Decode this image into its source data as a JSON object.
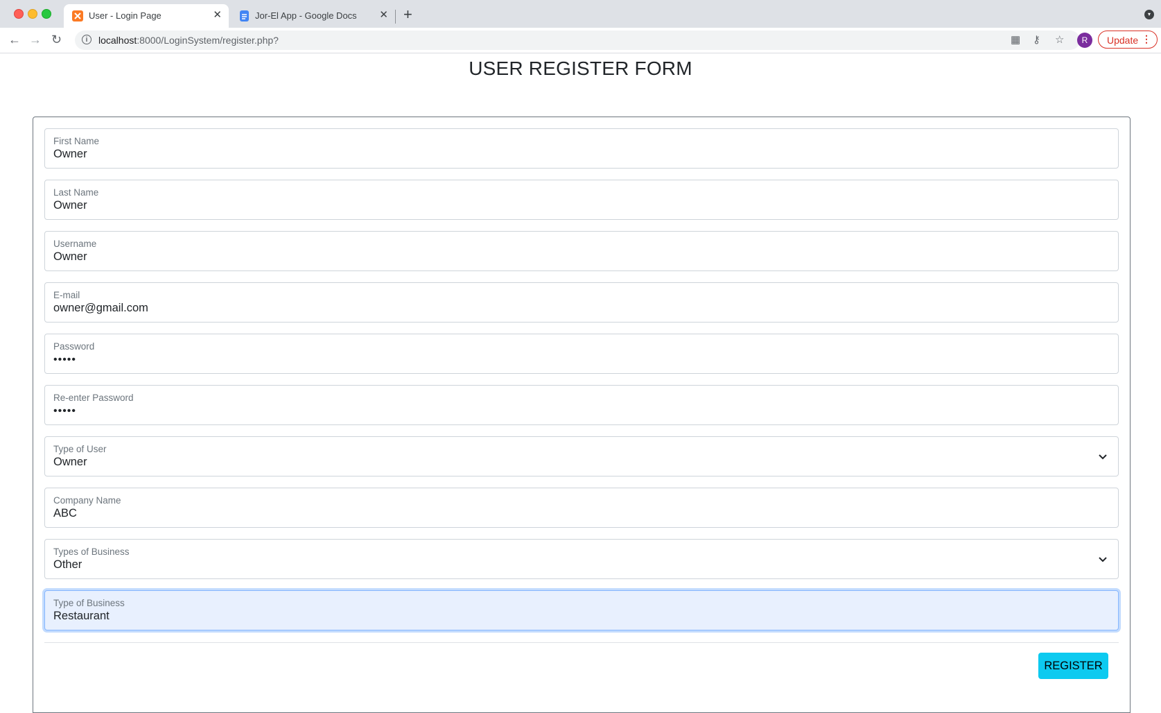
{
  "browser": {
    "tabs": [
      {
        "title": "User - Login Page",
        "active": true,
        "favicon": "xampp-icon"
      },
      {
        "title": "Jor-El App - Google Docs",
        "active": false,
        "favicon": "google-docs-icon"
      }
    ],
    "url_host": "localhost",
    "url_path": ":8000/LoginSystem/register.php?",
    "avatar_letter": "R",
    "update_label": "Update"
  },
  "page": {
    "heading": "USER REGISTER FORM",
    "fields": {
      "first_name": {
        "label": "First Name",
        "value": "Owner"
      },
      "last_name": {
        "label": "Last Name",
        "value": "Owner"
      },
      "username": {
        "label": "Username",
        "value": "Owner"
      },
      "email": {
        "label": "E-mail",
        "value": "owner@gmail.com"
      },
      "password": {
        "label": "Password",
        "masked": "•••••"
      },
      "reenter_password": {
        "label": "Re-enter Password",
        "masked": "•••••"
      },
      "type_of_user": {
        "label": "Type of User",
        "value": "Owner"
      },
      "company_name": {
        "label": "Company Name",
        "value": "ABC"
      },
      "types_of_business": {
        "label": "Types of Business",
        "value": "Other"
      },
      "type_of_business": {
        "label": "Type of Business",
        "value": "Restaurant"
      }
    },
    "register_label": "REGISTER"
  },
  "colors": {
    "accent": "#0dcaf0",
    "focus_bg": "#e8f0fe",
    "update_red": "#d93025"
  }
}
